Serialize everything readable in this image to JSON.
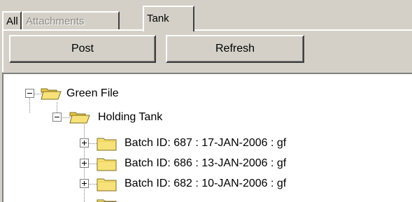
{
  "tabs": [
    {
      "label": "All",
      "state": "normal"
    },
    {
      "label": "Attachments",
      "state": "disabled"
    },
    {
      "label": "Tank",
      "state": "active"
    }
  ],
  "toolbar": {
    "post_label": "Post",
    "refresh_label": "Refresh"
  },
  "tree": {
    "root": {
      "label": "Green File",
      "expanded": true,
      "icon": "folder-open-icon"
    },
    "child": {
      "label": "Holding Tank",
      "expanded": true,
      "icon": "folder-open-icon"
    },
    "batches": [
      {
        "label": "Batch ID: 687 : 17-JAN-2006 : gf",
        "expanded": false,
        "icon": "folder-closed-icon"
      },
      {
        "label": "Batch ID: 686 : 13-JAN-2006 : gf",
        "expanded": false,
        "icon": "folder-closed-icon"
      },
      {
        "label": "Batch ID: 682 : 10-JAN-2006 : gf",
        "expanded": false,
        "icon": "folder-closed-icon"
      }
    ]
  },
  "colors": {
    "window_bg": "#d4d0c8",
    "tree_bg": "#ffffff",
    "folder_fill": "#f7e27a",
    "folder_stroke": "#7f6d1f"
  }
}
